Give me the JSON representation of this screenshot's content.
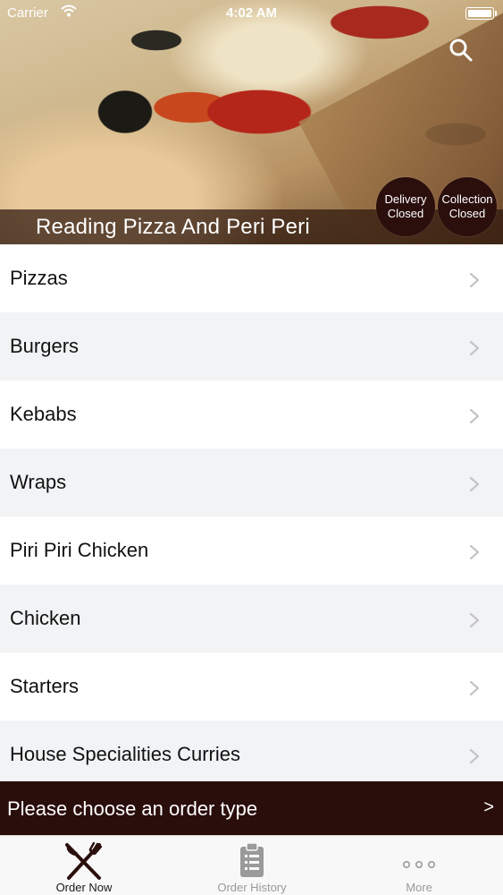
{
  "status_bar": {
    "carrier": "Carrier",
    "time": "4:02 AM"
  },
  "hero": {
    "restaurant_name": "Reading Pizza And Peri Peri",
    "delivery_badge": {
      "line1": "Delivery",
      "line2": "Closed"
    },
    "collection_badge": {
      "line1": "Collection",
      "line2": "Closed"
    },
    "search_icon": "search-icon"
  },
  "menu": {
    "items": [
      {
        "label": "Pizzas"
      },
      {
        "label": "Burgers"
      },
      {
        "label": "Kebabs"
      },
      {
        "label": "Wraps"
      },
      {
        "label": "Piri Piri Chicken"
      },
      {
        "label": "Chicken"
      },
      {
        "label": "Starters"
      },
      {
        "label": "House Specialities Curries"
      }
    ]
  },
  "order_bar": {
    "text": "Please choose an order type",
    "arrow": ">"
  },
  "tabbar": {
    "tabs": [
      {
        "label": "Order Now",
        "icon": "fork-knife-icon",
        "active": true
      },
      {
        "label": "Order History",
        "icon": "clipboard-icon",
        "active": false
      },
      {
        "label": "More",
        "icon": "more-dots-icon",
        "active": false
      }
    ]
  },
  "colors": {
    "brand_dark": "#2a0e0b",
    "row_alt": "#f1f3f5",
    "tab_inactive": "#9a9a9a"
  }
}
